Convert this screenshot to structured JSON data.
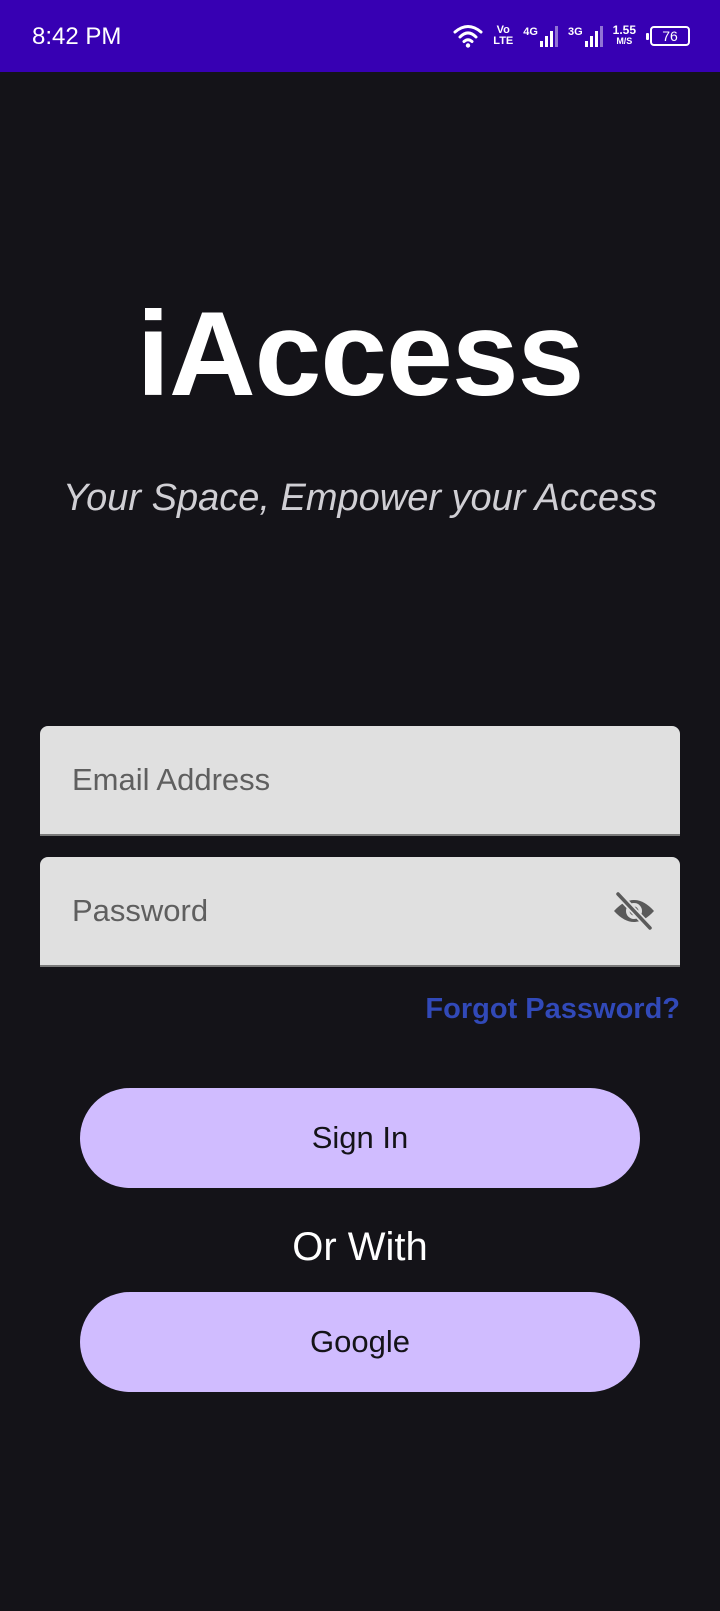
{
  "status_bar": {
    "time": "8:42 PM",
    "volte_top": "Vo",
    "volte_bottom": "LTE",
    "net1": "4G",
    "net2": "3G",
    "speed_value": "1.55",
    "speed_unit": "M/S",
    "battery": "76",
    "icons": [
      "wifi-icon",
      "signal-icon",
      "signal-icon",
      "battery-icon"
    ]
  },
  "header": {
    "title": "iAccess",
    "tagline": "Your Space, Empower your Access"
  },
  "form": {
    "email_placeholder": "Email Address",
    "email_value": "",
    "password_placeholder": "Password",
    "password_value": "",
    "password_toggle_icon": "eye-off-icon",
    "forgot_password": "Forgot Password?"
  },
  "actions": {
    "sign_in": "Sign In",
    "or_with": "Or With",
    "google": "Google"
  },
  "colors": {
    "background": "#141318",
    "status_bar": "#3700b3",
    "button": "#d0bcff",
    "link": "#3149b8",
    "field": "#e0e0e0"
  }
}
